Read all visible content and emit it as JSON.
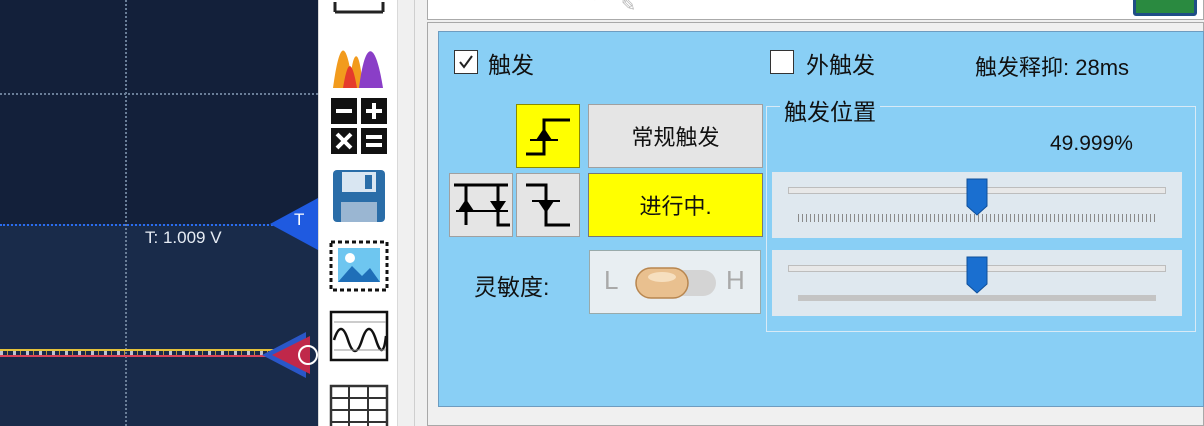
{
  "scope": {
    "trigger_level_label": "T: 1.009 V",
    "trigger_marker": "T",
    "channel_marker": "B",
    "colors": {
      "background": "#13203a",
      "trigger": "#2a6cf0",
      "channel_a": "#e3c23a",
      "channel_b": "#d8445a"
    }
  },
  "toolbar": {
    "icons": [
      "histogram-icon",
      "math-operators-icon",
      "save-icon",
      "image-export-icon",
      "waveform-icon",
      "table-icon"
    ]
  },
  "trigger": {
    "enable_label": "触发",
    "enable_checked": true,
    "external_label": "外触发",
    "external_checked": false,
    "holdoff_label": "触发释抑: 28ms",
    "mode_button": "常规触发",
    "status_button": "进行中.",
    "sensitivity_label": "灵敏度:",
    "toggle_low": "L",
    "toggle_high": "H",
    "position_title": "触发位置",
    "position_value": "49.999%",
    "position_fraction": 0.5,
    "level_fraction": 0.5,
    "edge_buttons": [
      "rising-edge",
      "both-edges",
      "falling-edge"
    ],
    "active_edge": "rising-edge",
    "colors": {
      "panel": "#89cff5",
      "active": "#ffff00",
      "slider_thumb": "#1a6fd0"
    }
  }
}
